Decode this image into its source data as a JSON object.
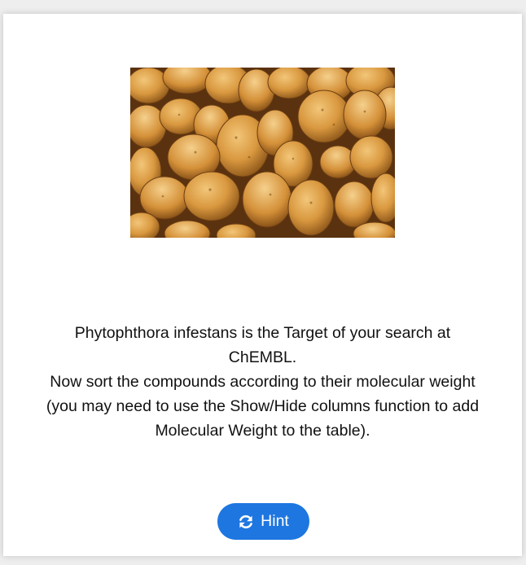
{
  "card": {
    "image_alt": "Potatoes",
    "message_lines": [
      "Phytophthora infestans is the Target  of your search at",
      "ChEMBL.",
      "Now sort the compounds according to their molecular weight",
      "(you may need to use the Show/Hide columns function to add",
      "Molecular Weight to the table)."
    ]
  },
  "hint_button": {
    "label": "Hint",
    "icon": "refresh-icon",
    "color": "#1e76e0"
  }
}
